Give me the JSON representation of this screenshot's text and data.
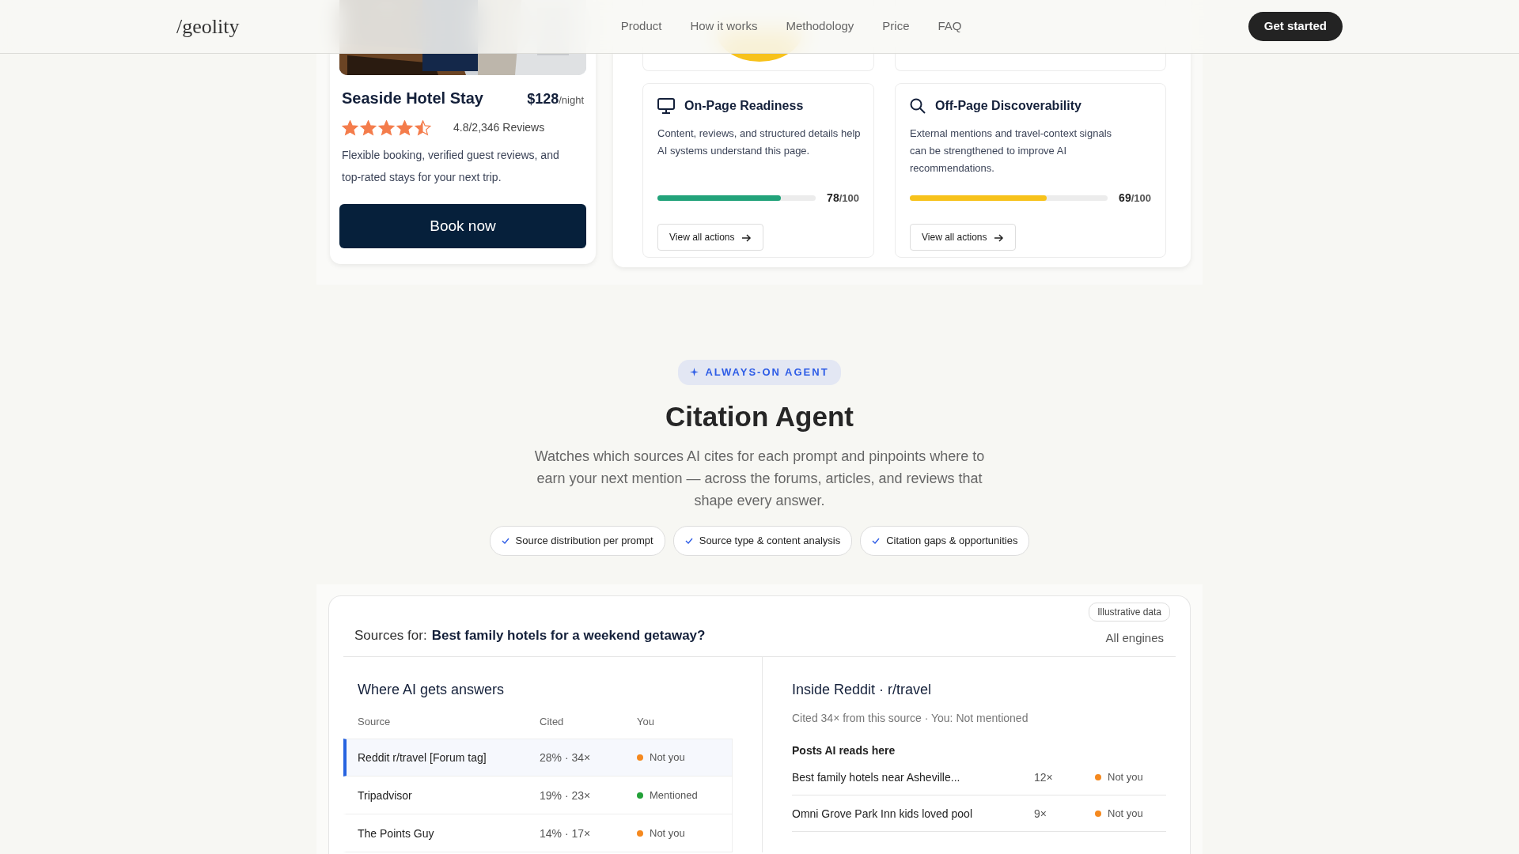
{
  "nav": {
    "logo": "/geolity",
    "links": [
      {
        "label": "Product"
      },
      {
        "label": "How it works"
      },
      {
        "label": "Methodology"
      },
      {
        "label": "Price"
      },
      {
        "label": "FAQ"
      }
    ],
    "cta": "Get started"
  },
  "hotel_card": {
    "title": "Seaside Hotel Stay",
    "price": "$128",
    "price_unit": "/night",
    "stars": 4.5,
    "rating": "4.8/2,346 Reviews",
    "description": "Flexible booking, verified guest reviews, and top-rated stays for your next trip.",
    "button": "Book now"
  },
  "score_cards": [
    {
      "title": "On-Page Readiness",
      "description": "Content, reviews, and structured details help AI systems understand this page.",
      "level": 0.78,
      "score": "78",
      "max": "/100",
      "color": "#22a37a",
      "action": "View all actions"
    },
    {
      "title": "Off-Page Discoverability",
      "description": "External mentions and travel-context signals can be strengthened to improve AI recommendations.",
      "level": 0.69,
      "score": "69",
      "max": "/100",
      "color": "#f7c21b",
      "action": "View all actions"
    }
  ],
  "agent": {
    "badge": "ALWAYS-ON AGENT",
    "title": "Citation Agent",
    "description": "Watches which sources AI cites for each prompt and pinpoints where to earn your next mention — across the forums, articles, and reviews that shape every answer.",
    "features": [
      "Source distribution per prompt",
      "Source type & content analysis",
      "Citation gaps & opportunities"
    ]
  },
  "sources_panel": {
    "tag": "Illustrative data",
    "prompt_label": "Sources for:",
    "prompt": "Best family hotels for a weekend getaway?",
    "engine": "All engines",
    "left": {
      "title": "Where AI gets answers",
      "columns": [
        "Source",
        "Cited",
        "You"
      ],
      "rows": [
        {
          "source": "Reddit r/travel [Forum tag]",
          "cited": "28% · 34×",
          "status": "Not you",
          "color": "#f5891f",
          "selected": true
        },
        {
          "source": "Tripadvisor",
          "cited": "19% · 23×",
          "status": "Mentioned",
          "color": "#23a139",
          "selected": false
        },
        {
          "source": "The Points Guy",
          "cited": "14% · 17×",
          "status": "Not you",
          "color": "#f5891f",
          "selected": false
        }
      ]
    },
    "right": {
      "title": "Inside Reddit · r/travel",
      "subtitle": "Cited 34× from this source · You: Not mentioned",
      "posts_title": "Posts AI reads here",
      "posts": [
        {
          "title": "Best family hotels near Asheville...",
          "count": "12×",
          "status": "Not you",
          "color": "#f5891f"
        },
        {
          "title": "Omni Grove Park Inn kids loved pool",
          "count": "9×",
          "status": "Not you",
          "color": "#f5891f"
        }
      ]
    }
  }
}
